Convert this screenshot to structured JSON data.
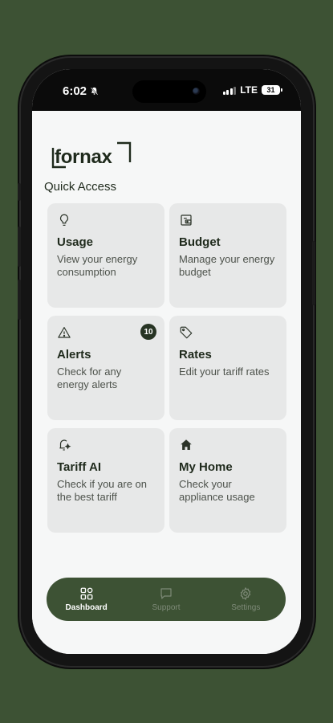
{
  "status_bar": {
    "time": "6:02",
    "network": "LTE",
    "battery": "31"
  },
  "app": {
    "logo": "fornax",
    "section_title": "Quick Access"
  },
  "cards": [
    {
      "title": "Usage",
      "desc": "View your energy consumption",
      "icon": "lightbulb-icon"
    },
    {
      "title": "Budget",
      "desc": "Manage your energy budget",
      "icon": "wallet-icon"
    },
    {
      "title": "Alerts",
      "desc": "Check for any energy alerts",
      "icon": "warning-icon",
      "badge": "10"
    },
    {
      "title": "Rates",
      "desc": "Edit your tariff rates",
      "icon": "tag-icon"
    },
    {
      "title": "Tariff AI",
      "desc": "Check if you are on the best tariff",
      "icon": "ai-bell-icon"
    },
    {
      "title": "My Home",
      "desc": "Check your appliance usage",
      "icon": "home-icon"
    }
  ],
  "nav": [
    {
      "label": "Dashboard",
      "icon": "dashboard-icon",
      "active": true
    },
    {
      "label": "Support",
      "icon": "chat-icon",
      "active": false
    },
    {
      "label": "Settings",
      "icon": "gear-icon",
      "active": false
    }
  ],
  "colors": {
    "brand": "#3d5234",
    "card_bg": "#e7e8e8",
    "badge": "#273424"
  }
}
